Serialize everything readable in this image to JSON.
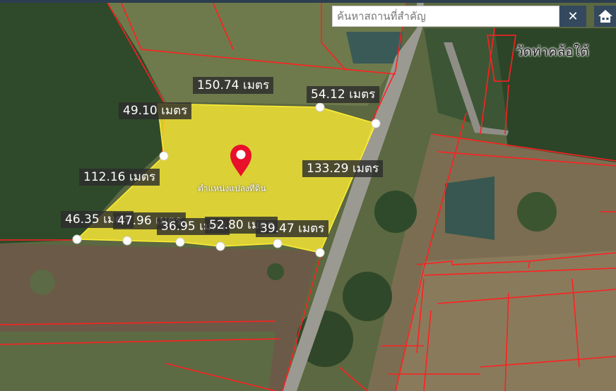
{
  "search": {
    "placeholder": "ค้นหาสถานที่สำคัญ",
    "value": ""
  },
  "buttons": {
    "clear_label": "✕",
    "home_icon": "home-icon"
  },
  "place_label": "วัดท่าคล้อใต้",
  "parcel": {
    "caption": "ตำแหน่งแปลงที่ดิน",
    "fill_color": "#ffee33",
    "marker_color": "#e8102a",
    "marker_icon": "map-pin-icon"
  },
  "distances": [
    {
      "id": "top",
      "text": "150.74 เมตร"
    },
    {
      "id": "top-right",
      "text": "54.12 เมตร"
    },
    {
      "id": "top-left",
      "text": "49.10 เมตร"
    },
    {
      "id": "right",
      "text": "133.29 เมตร"
    },
    {
      "id": "left",
      "text": "112.16 เมตร"
    },
    {
      "id": "bottom-1",
      "text": "46.35 เมตร"
    },
    {
      "id": "bottom-2",
      "text": "47.96 เมตร"
    },
    {
      "id": "bottom-3",
      "text": "36.95 เมตร"
    },
    {
      "id": "bottom-4",
      "text": "52.80 เมตร"
    },
    {
      "id": "bottom-5",
      "text": "39.47 เมตร"
    }
  ],
  "colors": {
    "boundary": "#ff2020",
    "button_bg": "#34495e"
  }
}
